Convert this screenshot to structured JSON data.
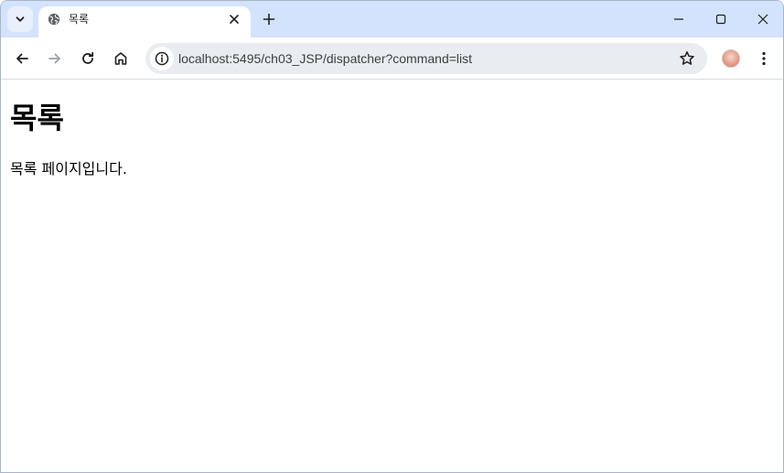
{
  "browser": {
    "tab": {
      "title": "목록",
      "favicon": "globe-icon",
      "close": "close-icon"
    },
    "new_tab": "plus-icon",
    "controls": [
      "minimize-icon",
      "maximize-icon",
      "close-icon"
    ],
    "toolbar": {
      "back": "back-arrow-icon",
      "forward": "forward-arrow-icon",
      "reload": "reload-icon",
      "home": "home-icon",
      "url": "localhost:5495/ch03_JSP/dispatcher?command=list",
      "bookmark": "star-icon",
      "menu": "more-vert-icon"
    },
    "colors": {
      "tabstrip": "#d3e3fd",
      "omnibox": "#e9ecf1",
      "active_tab": "#ffffff"
    }
  },
  "page": {
    "heading": "목록",
    "body_text": "목록 페이지입니다."
  }
}
